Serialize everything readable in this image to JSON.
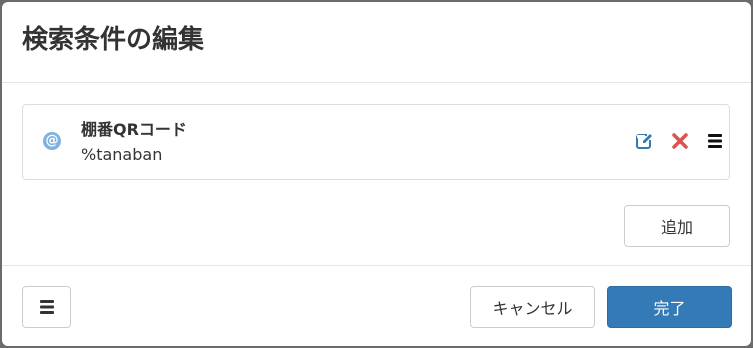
{
  "dialog": {
    "title": "検索条件の編集"
  },
  "conditions": [
    {
      "icon": "at-sign-icon",
      "name": "棚番QRコード",
      "value": "%tanaban"
    }
  ],
  "buttons": {
    "add": "追加",
    "cancel": "キャンセル",
    "done": "完了"
  },
  "colors": {
    "primary": "#337ab7",
    "edit_icon": "#337ab7",
    "delete_icon": "#d9534f",
    "at_icon": "#7fb2e0"
  }
}
